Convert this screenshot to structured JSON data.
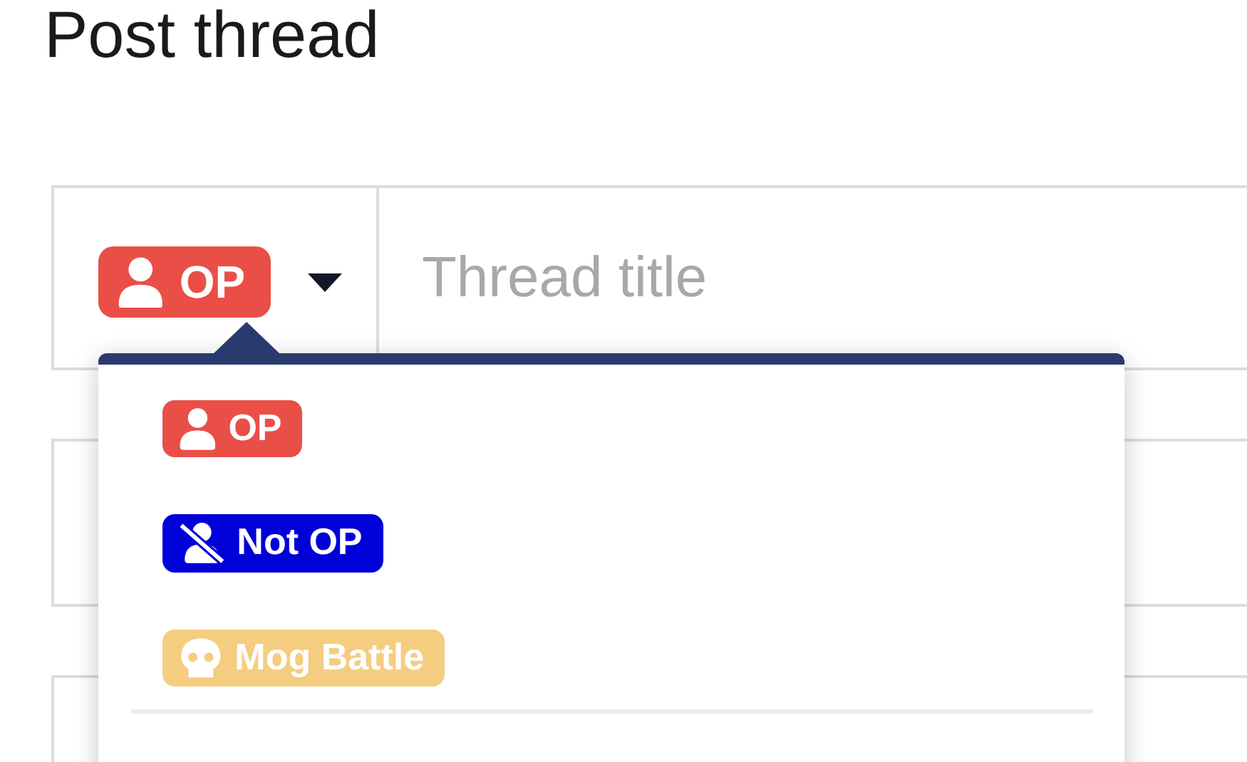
{
  "title": "Post thread",
  "prefix": {
    "label": "OP",
    "kind": "user",
    "color": "#e94f47"
  },
  "thread_title": {
    "placeholder": "Thread title"
  },
  "options": [
    {
      "label": "OP",
      "kind": "user",
      "color": "#e94f47"
    },
    {
      "label": "Not OP",
      "kind": "user-slash",
      "color": "#0000d8"
    },
    {
      "label": "Mog Battle",
      "kind": "skull",
      "color": "#f5cd80"
    }
  ]
}
